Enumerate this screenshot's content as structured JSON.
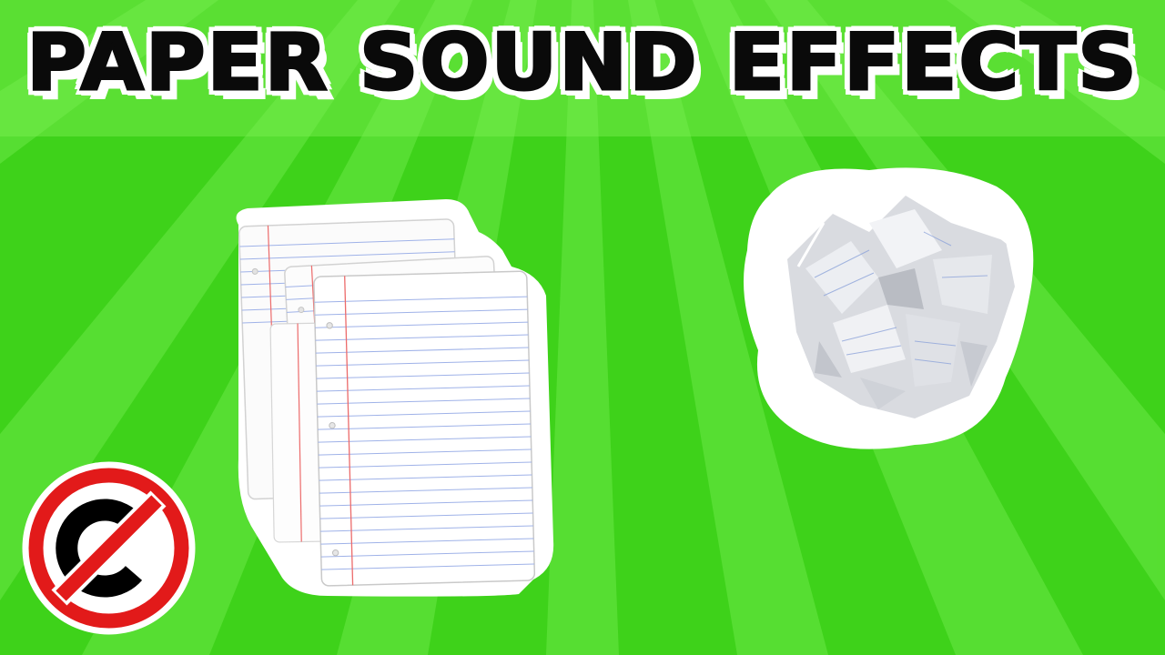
{
  "thumbnail": {
    "title": "PAPER SOUND EFFECTS",
    "background_color": "#3ed21a",
    "ray_color": "#6cf044"
  },
  "images": {
    "paper_stack": "lined-paper-stack",
    "crumpled_paper": "crumpled-paper-ball"
  },
  "badge": {
    "icon": "no-copyright-icon",
    "ring_color": "#e21a1a",
    "symbol_color": "#000000"
  }
}
